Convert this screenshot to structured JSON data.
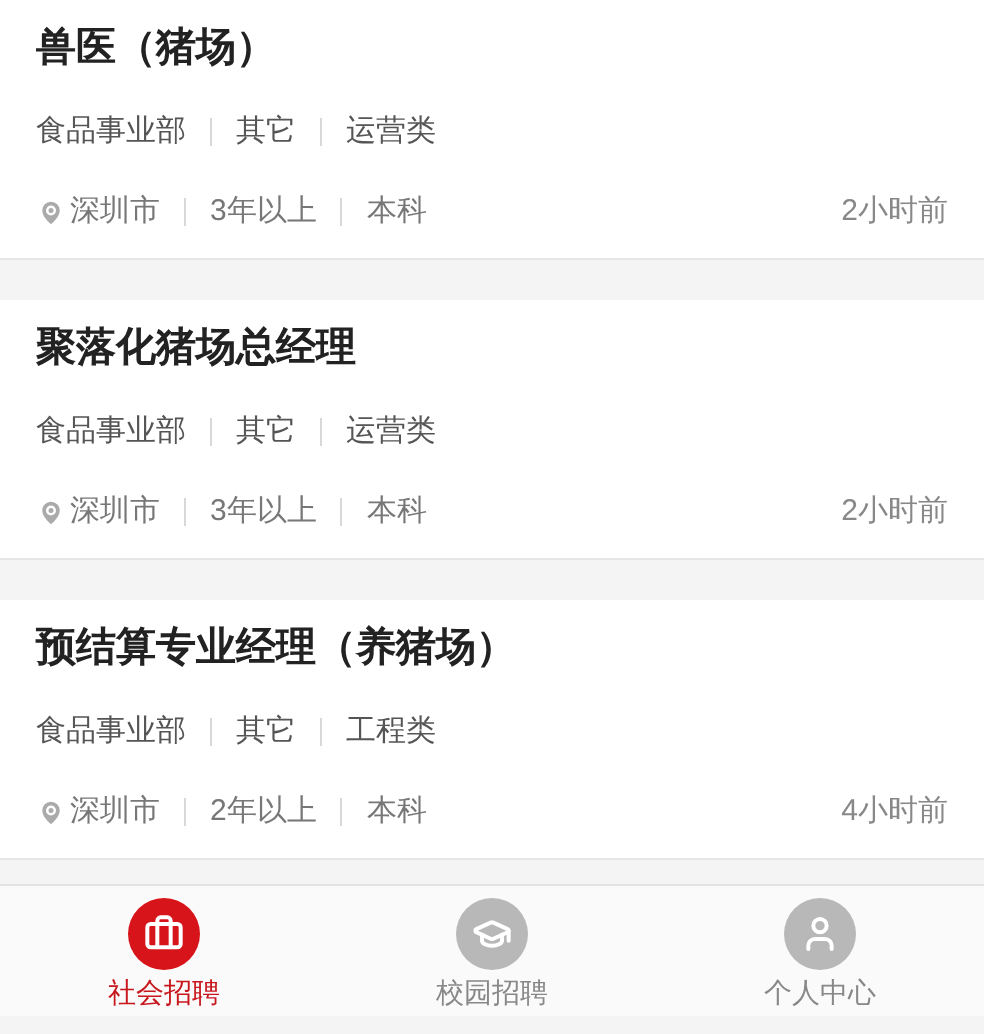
{
  "jobs": [
    {
      "title": "兽医（猪场）",
      "tags": [
        "食品事业部",
        "其它",
        "运营类"
      ],
      "meta": [
        "深圳市",
        "3年以上",
        "本科"
      ],
      "time": "2小时前"
    },
    {
      "title": "聚落化猪场总经理",
      "tags": [
        "食品事业部",
        "其它",
        "运营类"
      ],
      "meta": [
        "深圳市",
        "3年以上",
        "本科"
      ],
      "time": "2小时前"
    },
    {
      "title": "预结算专业经理（养猪场）",
      "tags": [
        "食品事业部",
        "其它",
        "工程类"
      ],
      "meta": [
        "深圳市",
        "2年以上",
        "本科"
      ],
      "time": "4小时前"
    }
  ],
  "nav": [
    {
      "kind": "social",
      "label": "社会招聘",
      "selected": true
    },
    {
      "kind": "campus",
      "label": "校园招聘",
      "selected": false
    },
    {
      "kind": "profile",
      "label": "个人中心",
      "selected": false
    }
  ]
}
